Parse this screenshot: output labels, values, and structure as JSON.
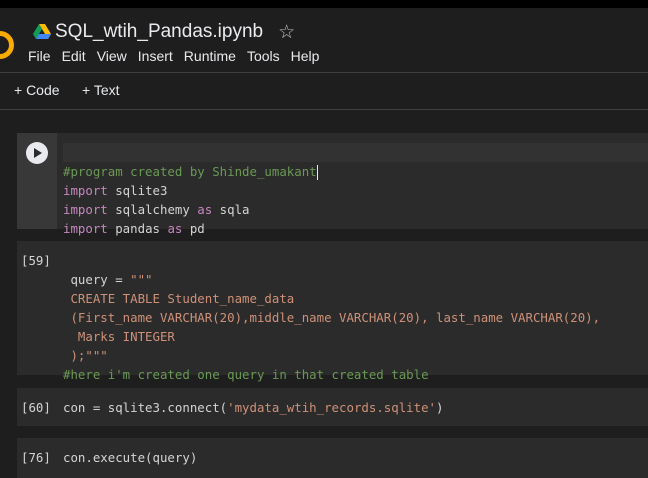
{
  "notebook": {
    "title": "SQL_wtih_Pandas.ipynb",
    "menu": [
      "File",
      "Edit",
      "View",
      "Insert",
      "Runtime",
      "Tools",
      "Help"
    ]
  },
  "toolbar": {
    "code_label": "+ Code",
    "text_label": "+ Text"
  },
  "cells": [
    {
      "exec_count": "",
      "lines": [
        "#program created by Shinde_umakant",
        "import sqlite3",
        "import sqlalchemy as sqla",
        "import pandas as pd"
      ]
    },
    {
      "exec_count": "[59]",
      "lines": [
        " query = \"\"\"",
        " CREATE TABLE Student_name_data",
        " (First_name VARCHAR(20),middle_name VARCHAR(20), last_name VARCHAR(20),",
        "  Marks INTEGER",
        " );\"\"\"",
        "#here i'm created one query in that created table"
      ]
    },
    {
      "exec_count": "[60]",
      "lines": [
        "con = sqlite3.connect('mydata_wtih_records.sqlite')"
      ]
    },
    {
      "exec_count": "[76]",
      "lines": [
        "con.execute(query)"
      ]
    }
  ],
  "colors": {
    "comment": "#6a9955",
    "keyword": "#c586c0",
    "string": "#ce9178"
  }
}
